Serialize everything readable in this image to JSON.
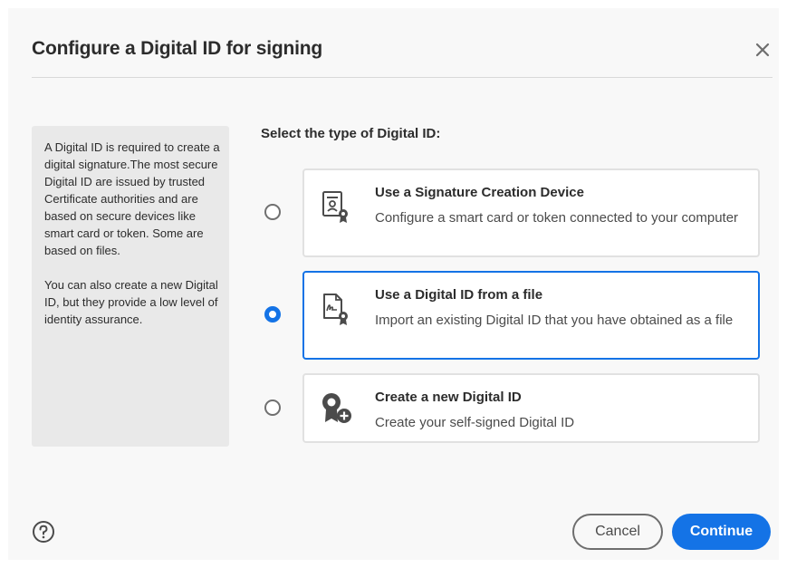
{
  "dialog": {
    "title": "Configure a Digital ID for signing",
    "close_icon": "close-icon"
  },
  "info": {
    "paragraph1": "A Digital ID is required to create a digital signature.The most secure Digital ID are issued by trusted Certificate authorities and are based on secure devices like smart card or token. Some are based on files.",
    "paragraph2": "You can also create a new Digital ID, but they provide a low level of identity assurance."
  },
  "section_label": "Select the type of Digital ID:",
  "options": [
    {
      "title": "Use a Signature Creation Device",
      "description": "Configure a smart card or token connected to your computer",
      "icon": "certificate-device-icon",
      "selected": false
    },
    {
      "title": "Use a Digital ID from a file",
      "description": "Import an existing Digital ID that you have obtained as a file",
      "icon": "signed-file-icon",
      "selected": true
    },
    {
      "title": "Create a new Digital ID",
      "description": "Create your self-signed Digital ID",
      "icon": "new-digital-id-icon",
      "selected": false
    }
  ],
  "footer": {
    "help_icon": "help-icon",
    "cancel_label": "Cancel",
    "continue_label": "Continue"
  },
  "colors": {
    "accent": "#1473e6",
    "panel_bg": "#e9e9e9",
    "dialog_bg": "#f8f8f8"
  }
}
